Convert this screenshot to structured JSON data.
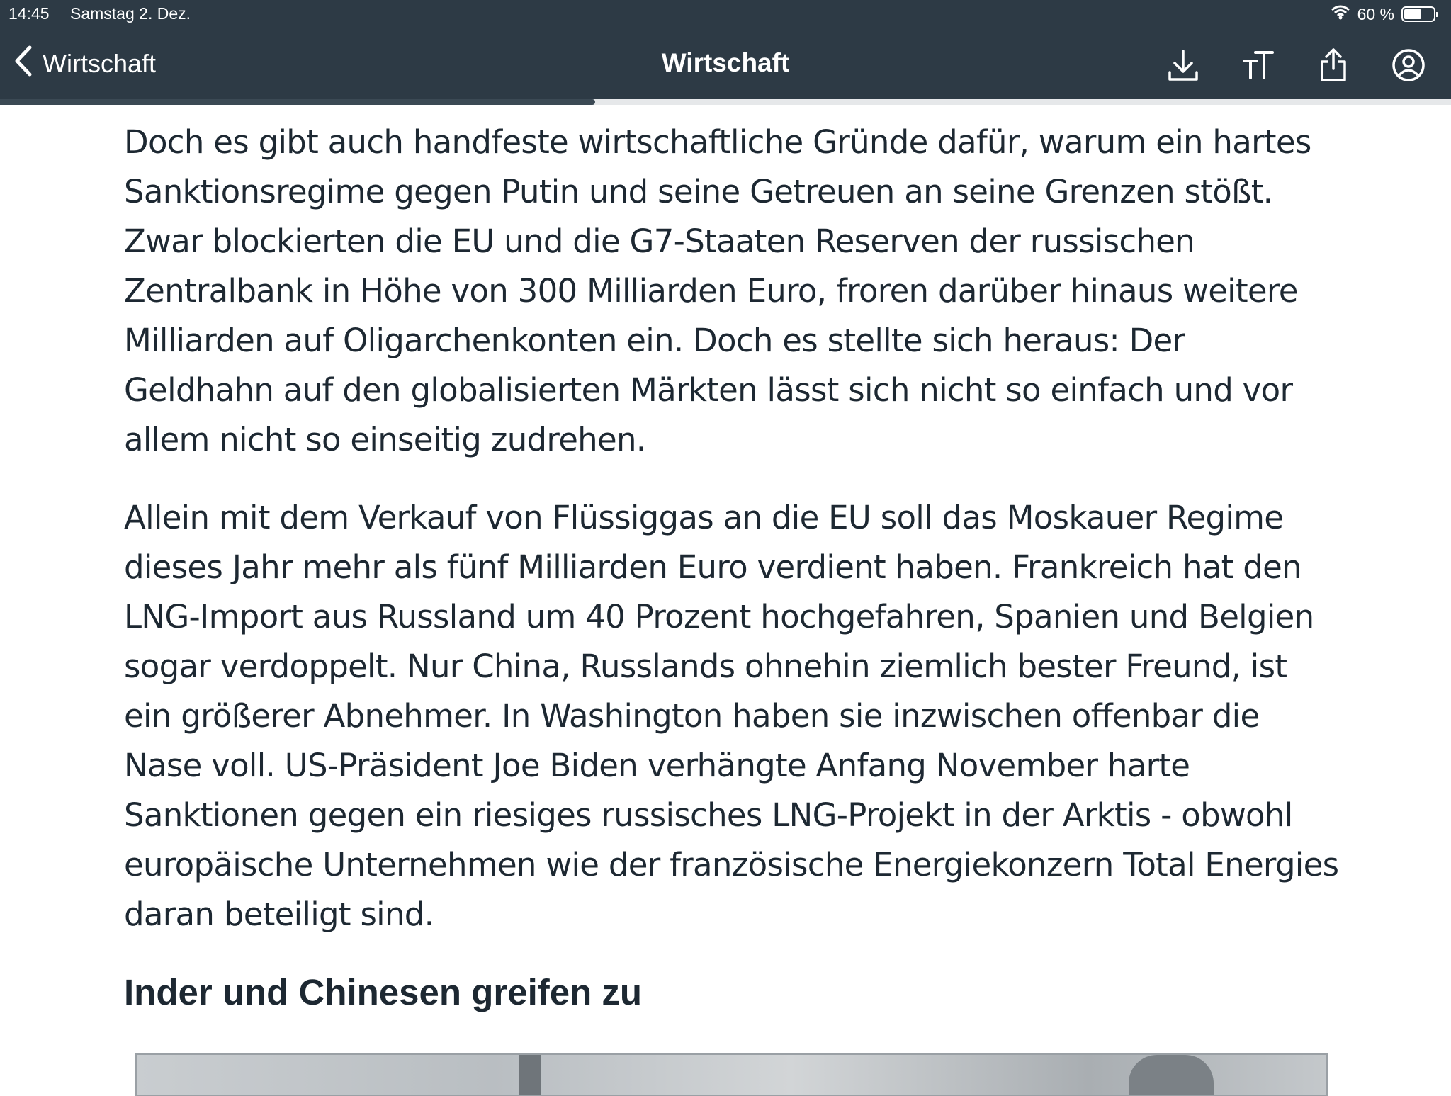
{
  "status_bar": {
    "time": "14:45",
    "date": "Samstag 2. Dez.",
    "battery": "60 %",
    "battery_level": 0.6
  },
  "nav": {
    "back_label": "Wirtschaft",
    "title": "Wirtschaft",
    "icons": [
      "download-icon",
      "text-size-icon",
      "share-icon",
      "account-icon"
    ]
  },
  "reading_progress": 0.41,
  "article": {
    "paragraphs": [
      "Doch es gibt auch handfeste wirtschaftliche Gründe dafür, warum ein hartes Sanktionsregime gegen Putin und seine Getreuen an seine Grenzen stößt. Zwar blockierten die EU und die G7-Staaten Reserven der russischen Zentralbank in Höhe von 300 Milliarden Euro, froren darüber hinaus weitere Milliarden auf Oligarchenkonten ein. Doch es stellte sich heraus: Der Geldhahn auf den globalisierten Märkten lässt sich nicht so einfach und vor allem nicht so einseitig zudrehen.",
      "Allein mit dem Verkauf von Flüssiggas an die EU soll das Moskauer Regime dieses Jahr mehr als fünf Milliarden Euro verdient haben. Frankreich hat den LNG-Import aus Russland um 40 Prozent hochgefahren, Spanien und Belgien sogar verdoppelt. Nur China, Russlands ohnehin ziemlich bester Freund, ist ein größerer Abnehmer. In Washington haben sie inzwischen offenbar die Nase voll. US-Präsident Joe Biden verhängte Anfang November harte Sanktionen gegen ein riesiges russisches LNG-Projekt in der Arktis - obwohl europäische Unternehmen wie der französische Energiekonzern Total Energies daran beteiligt sind."
    ],
    "subheading": "Inder und Chinesen greifen zu"
  },
  "colors": {
    "header_bg": "#2d3a45",
    "text": "#1d2832",
    "progress": "#3b4954"
  }
}
